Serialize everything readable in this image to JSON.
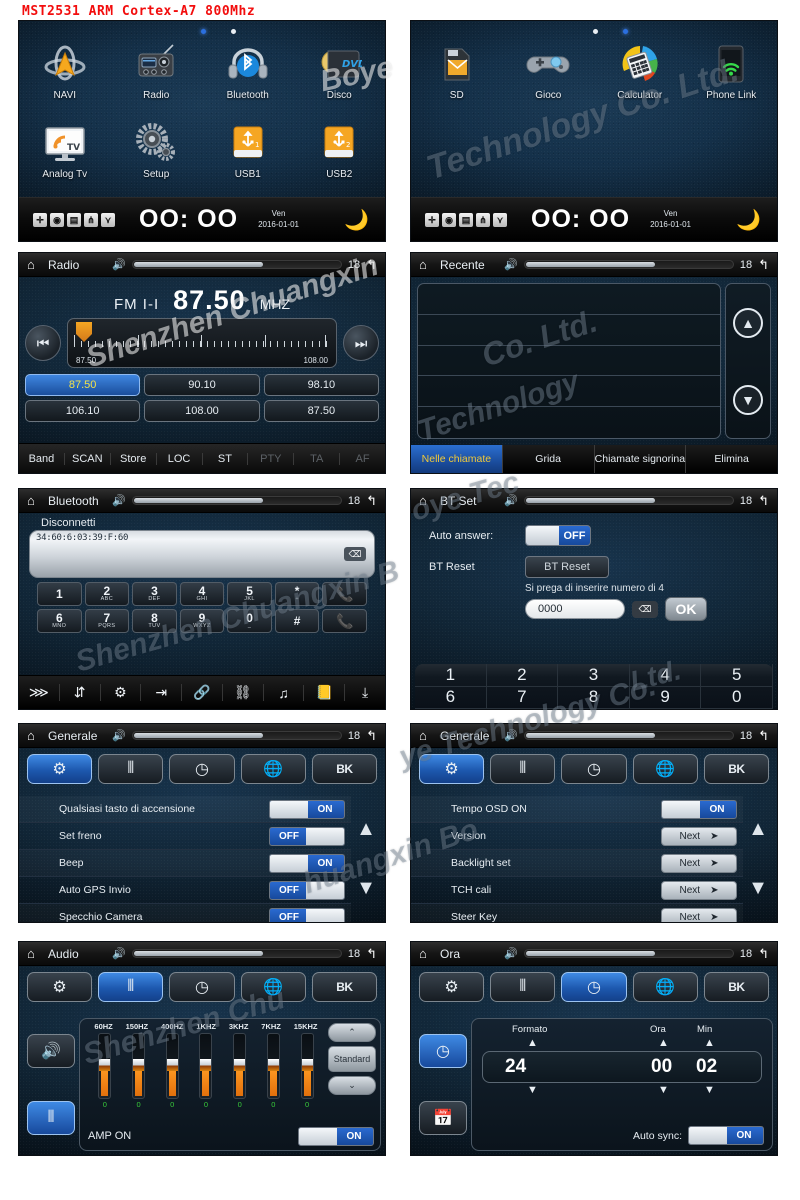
{
  "product_title": "MST2531 ARM Cortex-A7 800Mhz",
  "watermarks": [
    "Shenzhen Chuangxin Boye Technology Co. Ltd.",
    "Boye"
  ],
  "home_status": {
    "clock": "OO: OO",
    "day": "Ven",
    "date": "2016-01-01",
    "icons": [
      "bluetooth-icon",
      "power-icon",
      "list-icon",
      "eq-icon",
      "link-icon"
    ],
    "moon": "moon-icon"
  },
  "panels": {
    "home1": {
      "apps": [
        {
          "label": "NAVI",
          "icon": "navi-icon"
        },
        {
          "label": "Radio",
          "icon": "radio-icon"
        },
        {
          "label": "Bluetooth",
          "icon": "bluetooth-headphone-icon"
        },
        {
          "label": "Disco",
          "icon": "dvd-icon"
        },
        {
          "label": "Analog Tv",
          "icon": "tv-icon"
        },
        {
          "label": "Setup",
          "icon": "gears-icon"
        },
        {
          "label": "USB1",
          "icon": "usb1-icon"
        },
        {
          "label": "USB2",
          "icon": "usb2-icon"
        }
      ]
    },
    "home2": {
      "apps": [
        {
          "label": "SD",
          "icon": "sd-card-icon"
        },
        {
          "label": "Gioco",
          "icon": "gamepad-icon"
        },
        {
          "label": "Calculator",
          "icon": "calculator-icon"
        },
        {
          "label": "Phone Link",
          "icon": "phone-link-icon"
        }
      ]
    },
    "radio": {
      "title": "Radio",
      "volume": "18",
      "band": "FM I-I",
      "frequency": "87.50",
      "unit": "MHZ",
      "scale_low": "87.50",
      "scale_high": "108.00",
      "presets": [
        "87.50",
        "90.10",
        "98.10",
        "106.10",
        "108.00",
        "87.50"
      ],
      "active_preset_index": 0,
      "bottom_buttons": [
        {
          "label": "Band",
          "dim": false
        },
        {
          "label": "SCAN",
          "dim": false
        },
        {
          "label": "Store",
          "dim": false
        },
        {
          "label": "LOC",
          "dim": false
        },
        {
          "label": "ST",
          "dim": false
        },
        {
          "label": "PTY",
          "dim": true
        },
        {
          "label": "TA",
          "dim": true
        },
        {
          "label": "AF",
          "dim": true
        }
      ]
    },
    "recente": {
      "title": "Recente",
      "volume": "18",
      "rows": [
        "",
        "",
        "",
        "",
        ""
      ],
      "scroll_up": "scroll-up-icon",
      "scroll_down": "scroll-down-icon",
      "tabs": [
        {
          "label": "Nelle chiamate",
          "active": true
        },
        {
          "label": "Grida",
          "active": false
        },
        {
          "label": "Chiamate signorina",
          "active": false
        },
        {
          "label": "Elimina",
          "active": false
        }
      ]
    },
    "bluetooth": {
      "title": "Bluetooth",
      "volume": "18",
      "status": "Disconnetti",
      "device_address": "34:60:6:03:39:F:60",
      "delete_icon": "backspace-icon",
      "keys": [
        {
          "num": "1",
          "sub": ""
        },
        {
          "num": "2",
          "sub": "ABC"
        },
        {
          "num": "3",
          "sub": "DEF"
        },
        {
          "num": "4",
          "sub": "GHI"
        },
        {
          "num": "5",
          "sub": "JKL"
        },
        {
          "num": "*",
          "sub": "+"
        },
        {
          "num": "6",
          "sub": "MNO"
        },
        {
          "num": "7",
          "sub": "PQRS"
        },
        {
          "num": "8",
          "sub": "TUV"
        },
        {
          "num": "9",
          "sub": "WXYZ"
        },
        {
          "num": "0",
          "sub": "_"
        },
        {
          "num": "#",
          "sub": ""
        }
      ],
      "call_button": "call-answer-icon",
      "hangup_button": "call-hangup-icon",
      "toolbar": [
        "dialpad-icon",
        "download-contacts-icon",
        "bt-settings-icon",
        "handover-icon",
        "link-icon",
        "unlink-icon",
        "bt-music-icon",
        "phonebook-icon",
        "sync-download-icon"
      ]
    },
    "btset": {
      "title": "BT Set",
      "volume": "18",
      "auto_answer_label": "Auto answer:",
      "auto_answer_state": "OFF",
      "bt_reset_label": "BT Reset",
      "bt_reset_button": "BT Reset",
      "pin_hint": "Si prega di inserire numero di 4",
      "pin_value": "0000",
      "ok_label": "OK",
      "delete_icon": "backspace-icon",
      "keypad": [
        "1",
        "2",
        "3",
        "4",
        "5",
        "6",
        "7",
        "8",
        "9",
        "0"
      ]
    },
    "generale1": {
      "title": "Generale",
      "volume": "18",
      "tabs": [
        {
          "icon": "gear-icon",
          "active": true
        },
        {
          "icon": "equalizer-icon",
          "active": false
        },
        {
          "icon": "clock-icon",
          "active": false
        },
        {
          "icon": "globe-search-icon",
          "active": false
        },
        {
          "icon": "bk-icon",
          "label": "BK",
          "active": false
        }
      ],
      "rows": [
        {
          "label": "Qualsiasi tasto di accensione",
          "type": "toggle",
          "state": "ON"
        },
        {
          "label": "Set freno",
          "type": "toggle",
          "state": "OFF"
        },
        {
          "label": "Beep",
          "type": "toggle",
          "state": "ON"
        },
        {
          "label": "Auto GPS Invio",
          "type": "toggle",
          "state": "OFF"
        },
        {
          "label": "Specchio Camera",
          "type": "toggle",
          "state": "OFF"
        }
      ],
      "scroll_up": "scroll-up-icon",
      "scroll_down": "scroll-down-icon"
    },
    "generale2": {
      "title": "Generale",
      "volume": "18",
      "tabs": [
        {
          "icon": "gear-icon",
          "active": true
        },
        {
          "icon": "equalizer-icon",
          "active": false
        },
        {
          "icon": "clock-icon",
          "active": false
        },
        {
          "icon": "globe-search-icon",
          "active": false
        },
        {
          "icon": "bk-icon",
          "label": "BK",
          "active": false
        }
      ],
      "rows": [
        {
          "label": "Tempo OSD ON",
          "type": "toggle",
          "state": "ON"
        },
        {
          "label": "Version",
          "type": "next",
          "button": "Next"
        },
        {
          "label": "Backlight set",
          "type": "next",
          "button": "Next"
        },
        {
          "label": "TCH cali",
          "type": "next",
          "button": "Next"
        },
        {
          "label": "Steer Key",
          "type": "next",
          "button": "Next"
        }
      ],
      "scroll_up": "scroll-up-icon",
      "scroll_down": "scroll-down-icon"
    },
    "audio": {
      "title": "Audio",
      "volume": "18",
      "tabs": [
        {
          "icon": "gear-icon",
          "active": false
        },
        {
          "icon": "equalizer-icon",
          "active": true
        },
        {
          "icon": "clock-icon",
          "active": false
        },
        {
          "icon": "globe-search-icon",
          "active": false
        },
        {
          "icon": "bk-icon",
          "label": "BK",
          "active": false
        }
      ],
      "side_buttons": [
        {
          "icon": "speaker-icon",
          "active": false
        },
        {
          "icon": "equalizer-icon",
          "active": true
        }
      ],
      "bands": [
        "60HZ",
        "150HZ",
        "400HZ",
        "1KHZ",
        "3KHZ",
        "7KHZ",
        "15KHZ"
      ],
      "values": [
        "0",
        "0",
        "0",
        "0",
        "0",
        "0",
        "0"
      ],
      "preset_up": "scroll-up-icon",
      "preset_name": "Standard",
      "preset_down": "scroll-down-icon",
      "amp_label": "AMP ON",
      "amp_state": "ON"
    },
    "ora": {
      "title": "Ora",
      "volume": "18",
      "tabs": [
        {
          "icon": "gear-icon",
          "active": false
        },
        {
          "icon": "equalizer-icon",
          "active": false
        },
        {
          "icon": "clock-icon",
          "active": true
        },
        {
          "icon": "globe-search-icon",
          "active": false
        },
        {
          "icon": "bk-icon",
          "label": "BK",
          "active": false
        }
      ],
      "side_buttons": [
        {
          "icon": "clock-face-icon",
          "active": true
        },
        {
          "icon": "calendar-icon",
          "active": false
        }
      ],
      "headers": {
        "format": "Formato",
        "hour": "Ora",
        "min": "Min"
      },
      "format_value": "24",
      "hour_value": "00",
      "min_value": "02",
      "auto_sync_label": "Auto sync:",
      "auto_sync_state": "ON"
    }
  },
  "chart_data": null
}
